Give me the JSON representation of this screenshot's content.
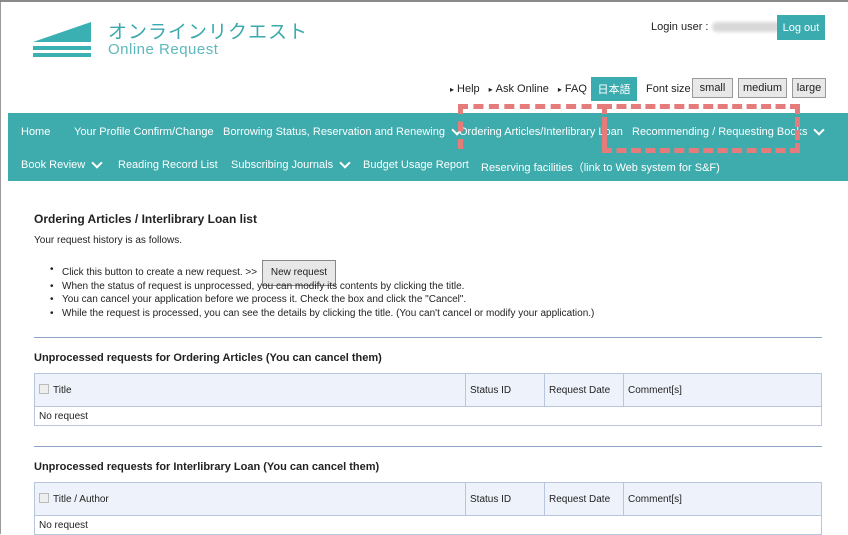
{
  "header": {
    "brand_jp": "オンラインリクエスト",
    "brand_en": "Online Request",
    "login_label": "Login user :",
    "logout_label": "Log out",
    "colors": {
      "accent": "#3aacb0",
      "nav": "#3eabad",
      "highlight": "#e57b7b"
    }
  },
  "util": {
    "help": "Help",
    "ask": "Ask Online",
    "faq": "FAQ",
    "lang": "日本語",
    "font_size_label": "Font size",
    "small": "small",
    "medium": "medium",
    "large": "large"
  },
  "nav": {
    "items": [
      "Home",
      "Your Profile Confirm/Change",
      "Borrowing Status, Reservation and Renewing",
      "Ordering Articles/Interlibrary Loan",
      "Recommending / Requesting Books",
      "Book Review",
      "Reading Record List",
      "Subscribing Journals",
      "Budget Usage Report",
      "Reserving facilities（link to Web system for S&F)"
    ]
  },
  "main": {
    "title": "Ordering Articles / Interlibrary Loan list",
    "intro": "Your request history is as follows.",
    "bullet1": "Click this button to create a new request. >>",
    "new_request_label": "New request",
    "bullet2": "When the status of request is unprocessed, you can modify its contents by clicking the title.",
    "bullet3": "You can cancel your application before we process it. Check the box and click the \"Cancel\".",
    "bullet4": "While the request is processed, you can see the details by clicking the title. (You can't cancel or modify your application.)",
    "section1": {
      "heading": "Unprocessed requests for Ordering Articles (You can cancel them)",
      "columns": [
        "Title",
        "Status ID",
        "Request Date",
        "Comment[s]"
      ],
      "empty": "No request"
    },
    "section2": {
      "heading": "Unprocessed requests for Interlibrary Loan (You can cancel them)",
      "columns": [
        "Title / Author",
        "Status ID",
        "Request Date",
        "Comment[s]"
      ],
      "empty": "No request"
    }
  }
}
